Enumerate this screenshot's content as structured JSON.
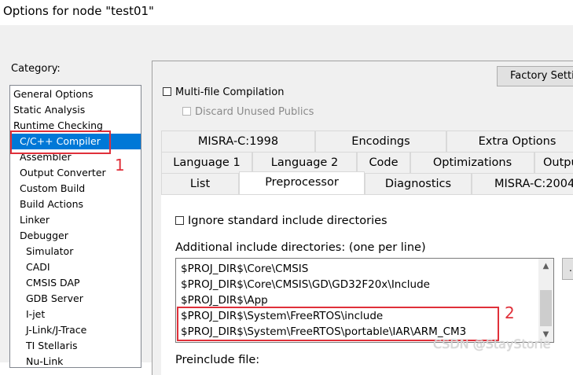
{
  "window": {
    "title": "Options for node \"test01\""
  },
  "category": {
    "label": "Category:",
    "items": [
      "General Options",
      "Static Analysis",
      "Runtime Checking",
      "C/C++ Compiler",
      "Assembler",
      "Output Converter",
      "Custom Build",
      "Build Actions",
      "Linker",
      "Debugger",
      "Simulator",
      "CADI",
      "CMSIS DAP",
      "GDB Server",
      "I-jet",
      "J-Link/J-Trace",
      "TI Stellaris",
      "Nu-Link"
    ],
    "selected": "C/C++ Compiler"
  },
  "toolbar": {
    "factory_settings": "Factory Settings"
  },
  "options": {
    "multi_file": "Multi-file Compilation",
    "discard_unused": "Discard Unused Publics"
  },
  "tabs": {
    "row1": [
      "MISRA-C:1998",
      "Encodings",
      "Extra Options"
    ],
    "row2": [
      "Language 1",
      "Language 2",
      "Code",
      "Optimizations",
      "Output"
    ],
    "row3": [
      "List",
      "Preprocessor",
      "Diagnostics",
      "MISRA-C:2004"
    ],
    "active": "Preprocessor"
  },
  "preprocessor": {
    "ignore_std": "Ignore standard include directories",
    "additional_label": "Additional include directories: (one per line)",
    "include_dirs": [
      "$PROJ_DIR$\\Core\\CMSIS",
      "$PROJ_DIR$\\Core\\CMSIS\\GD\\GD32F20x\\Include",
      "$PROJ_DIR$\\App",
      "$PROJ_DIR$\\System\\FreeRTOS\\include",
      "$PROJ_DIR$\\System\\FreeRTOS\\portable\\IAR\\ARM_CM3"
    ],
    "browse": "...",
    "preinclude_label": "Preinclude file:"
  },
  "annotations": {
    "mark1": "1",
    "mark2": "2"
  },
  "watermark": "CSDN @StayStorie",
  "colors": {
    "selection": "#0078d7",
    "annotation": "#e0303a"
  }
}
